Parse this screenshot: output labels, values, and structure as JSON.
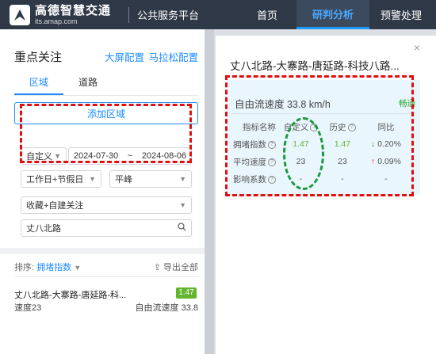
{
  "header": {
    "logo_cn": "高德智慧交通",
    "logo_en": "its.amap.com",
    "platform": "公共服务平台",
    "nav": [
      "首页",
      "研判分析",
      "预警处理"
    ]
  },
  "left": {
    "title": "重点关注",
    "links": [
      "大屏配置",
      "马拉松配置"
    ],
    "tabs": [
      "区域",
      "道路"
    ],
    "add_button": "添加区域",
    "date_type": "自定义",
    "date_start": "2024-07-30",
    "date_sep": "~",
    "date_end": "2024-08-06",
    "day_type": "工作日+节假日",
    "peak": "平峰",
    "follow": "收藏+自建关注",
    "search_value": "丈八北路",
    "sort_label": "排序:",
    "sort_value": "拥堵指数",
    "export": "导出全部",
    "item": {
      "title": "丈八北路-大寨路-唐延路-科...",
      "badge": "1.47",
      "speed": "速度23",
      "free_flow": "自由流速度 33.8"
    }
  },
  "popup": {
    "title": "丈八北路-大寨路-唐延路-科技八路...",
    "close": "×",
    "free_flow_label": "自由流速度 33.8 km/h",
    "status": "畅通",
    "table": {
      "headers": [
        "指标名称",
        "自定义",
        "历史",
        "同比"
      ],
      "rows": [
        {
          "name": "拥堵指数",
          "custom": "1.47",
          "history": "1.47",
          "yoy": "0.20%",
          "trend": "down"
        },
        {
          "name": "平均速度",
          "custom": "23",
          "history": "23",
          "yoy": "0.09%",
          "trend": "up"
        },
        {
          "name": "影响系数",
          "custom": "-",
          "history": "-",
          "yoy": "-",
          "trend": "none"
        }
      ]
    }
  },
  "colors": {
    "accent": "#1e8cff",
    "topbar": "#2f3846",
    "highlight_box": "#e01010",
    "oval": "#1a9a3a"
  }
}
